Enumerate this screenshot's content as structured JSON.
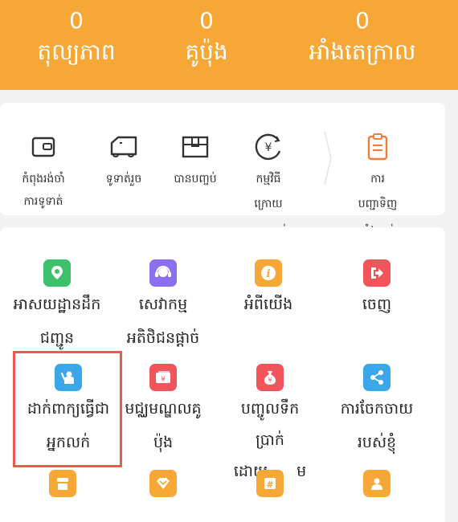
{
  "header": {
    "stats": [
      {
        "value": "0",
        "label": "តុល្យភាព"
      },
      {
        "value": "0",
        "label": "គូប៉ុង"
      },
      {
        "value": "0",
        "label": "អាំងតេក្រាល"
      }
    ]
  },
  "orders": {
    "items": [
      {
        "label1": "កំពុងរង់ចាំ",
        "label2": "ការទូទាត់",
        "icon": "wallet-icon"
      },
      {
        "label1": "ទូទាត់រួច",
        "label2": "",
        "icon": "truck-icon"
      },
      {
        "label1": "បានបញ្ចប់",
        "label2": "",
        "icon": "box-icon"
      },
      {
        "label1": "កម្មវិធី",
        "label2": "ក្រោយ",
        "label3": "ពេលលក់",
        "icon": "yen-circle-icon"
      },
      {
        "label1": "ការ",
        "label2": "បញ្ជាទិញ",
        "label3": "ទាំងអស់",
        "icon": "clipboard-icon"
      }
    ]
  },
  "grid": {
    "items": [
      {
        "label1": "អាសយដ្ឋានដឹក",
        "label2": "ជញ្ជូន",
        "icon": "location-icon",
        "color": "#3cc16a"
      },
      {
        "label1": "សេវាកម្ម",
        "label2": "អតិថិជនផ្ដាច់",
        "icon": "headset-icon",
        "color": "#8a6ff0"
      },
      {
        "label1": "អំពីយើង",
        "label2": "",
        "icon": "info-icon",
        "color": "#f7a735"
      },
      {
        "label1": "ចេញ",
        "label2": "",
        "icon": "logout-icon",
        "color": "#f2545b"
      },
      {
        "label1": "ដាក់ពាក្យធ្វើជា",
        "label2": "អ្នកលក់",
        "icon": "seller-icon",
        "color": "#3ba7ea"
      },
      {
        "label1": "មជ្ឈមណ្ឌលគូ",
        "label2": "ប៉ុង",
        "icon": "coupon-icon",
        "color": "#f2545b"
      },
      {
        "label1": "បញ្ចូលទឹក",
        "label2": "ប្រាក់",
        "label3": "ដោយ",
        "label4": "ម",
        "icon": "moneybag-icon",
        "color": "#f2545b"
      },
      {
        "label1": "ការចែកចាយ",
        "label2": "របស់ខ្ញុំ",
        "icon": "share-icon",
        "color": "#3ba7ea"
      },
      {
        "label1": "",
        "icon": "shop-icon",
        "color": "#f7a735"
      },
      {
        "label1": "",
        "icon": "diamond-icon",
        "color": "#f7a735"
      },
      {
        "label1": "",
        "icon": "hash-icon",
        "color": "#f7a735"
      },
      {
        "label1": "",
        "icon": "person-card-icon",
        "color": "#f7a735"
      }
    ]
  }
}
